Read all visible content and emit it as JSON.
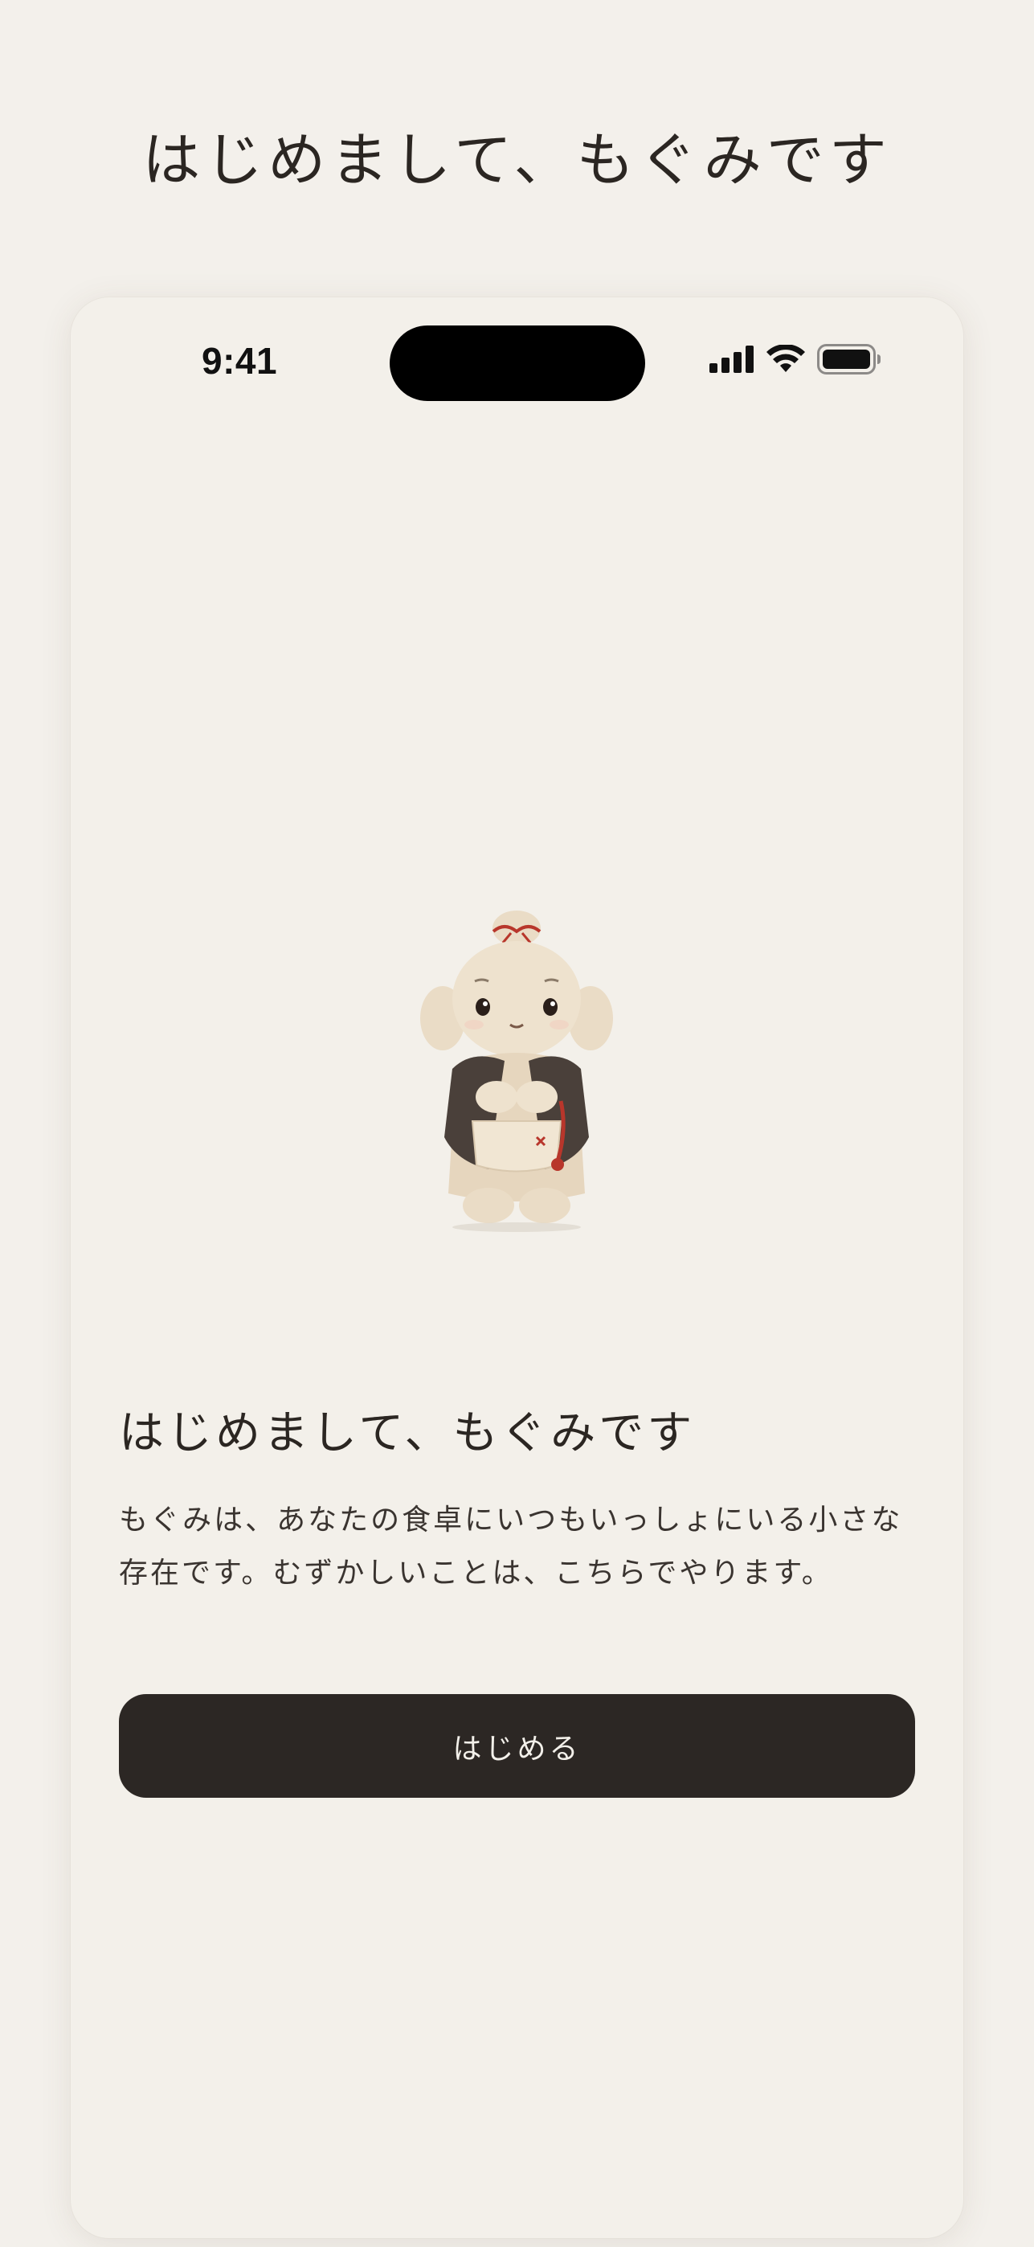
{
  "page": {
    "heading": "はじめまして、もぐみです"
  },
  "status_bar": {
    "time": "9:41",
    "icons": [
      "cellular-signal-icon",
      "wifi-icon",
      "battery-icon"
    ]
  },
  "mascot": {
    "icon": "mogumi-mascot-figure"
  },
  "welcome": {
    "title": "はじめまして、もぐみです",
    "body": "もぐみは、あなたの食卓にいつもいっしょにいる小さな存在です。むずかしいことは、こちらでやります。",
    "start_label": "はじめる"
  },
  "colors": {
    "background": "#F3F0EB",
    "button": "#2C2724",
    "text": "#2B2622"
  }
}
